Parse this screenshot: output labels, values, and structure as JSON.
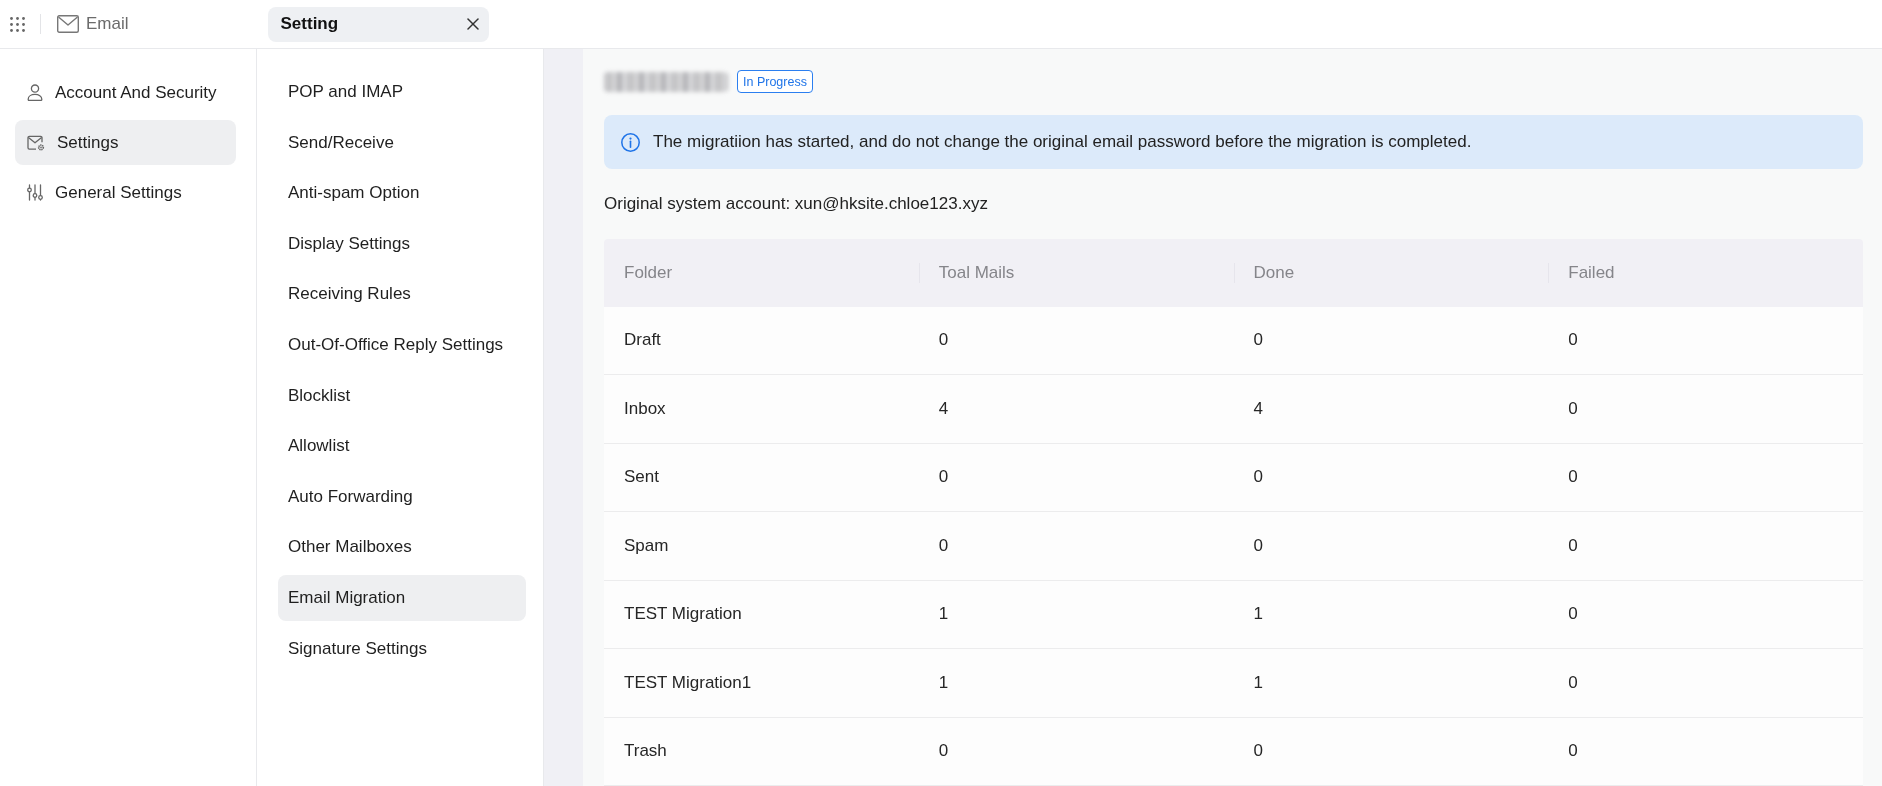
{
  "top_bar": {
    "app_name": "Email",
    "tabs": [
      {
        "label": "Setting",
        "selected": true
      }
    ]
  },
  "sidebar": {
    "items": [
      {
        "label": "Account And Security",
        "selected": false
      },
      {
        "label": "Settings",
        "selected": true
      },
      {
        "label": "General Settings",
        "selected": false
      }
    ]
  },
  "settings_menu": {
    "items": [
      {
        "label": "POP and IMAP",
        "selected": false
      },
      {
        "label": "Send/Receive",
        "selected": false
      },
      {
        "label": "Anti-spam Option",
        "selected": false
      },
      {
        "label": "Display Settings",
        "selected": false
      },
      {
        "label": "Receiving Rules",
        "selected": false
      },
      {
        "label": "Out-Of-Office Reply Settings",
        "selected": false
      },
      {
        "label": "Blocklist",
        "selected": false
      },
      {
        "label": "Allowlist",
        "selected": false
      },
      {
        "label": "Auto Forwarding",
        "selected": false
      },
      {
        "label": "Other Mailboxes",
        "selected": false
      },
      {
        "label": "Email Migration",
        "selected": true
      },
      {
        "label": "Signature Settings",
        "selected": false
      }
    ]
  },
  "migration": {
    "title_blurred": true,
    "status": "In Progress",
    "notice": "The migratiion has started, and do not change the original email password before the migration is completed.",
    "account": "Original system account: xun@hksite.chloe123.xyz"
  },
  "table": {
    "columns": [
      "Folder",
      "Toal Mails",
      "Done",
      "Failed"
    ],
    "rows": [
      [
        "Draft",
        "0",
        "0",
        "0"
      ],
      [
        "Inbox",
        "4",
        "4",
        "0"
      ],
      [
        "Sent",
        "0",
        "0",
        "0"
      ],
      [
        "Spam",
        "0",
        "0",
        "0"
      ],
      [
        "TEST Migration",
        "1",
        "1",
        "0"
      ],
      [
        "TEST Migration1",
        "1",
        "1",
        "0"
      ],
      [
        "Trash",
        "0",
        "0",
        "0"
      ]
    ]
  }
}
